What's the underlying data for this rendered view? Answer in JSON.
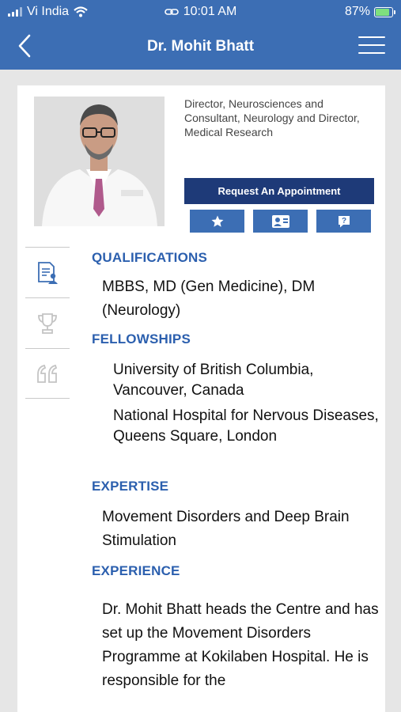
{
  "status": {
    "carrier": "Vi India",
    "time": "10:01 AM",
    "battery": "87%",
    "battery_level": 0.87
  },
  "nav": {
    "title": "Dr. Mohit Bhatt"
  },
  "profile": {
    "designation": "Director, Neurosciences and Consultant, Neurology and Director, Medical Research",
    "appointment_label": "Request An Appointment"
  },
  "sections": {
    "qualifications": {
      "heading": "QUALIFICATIONS",
      "text": "MBBS, MD (Gen Medicine), DM (Neurology)"
    },
    "fellowships": {
      "heading": "FELLOWSHIPS",
      "items": [
        "University of British Columbia, Vancouver, Canada",
        "National Hospital for Nervous Diseases, Queens Square, London"
      ]
    },
    "expertise": {
      "heading": "EXPERTISE",
      "text": "Movement Disorders and Deep Brain Stimulation"
    },
    "experience": {
      "heading": "EXPERIENCE",
      "text": "Dr. Mohit Bhatt heads the Centre and has set up the Movement Disorders Programme at Kokilaben Hospital. He is responsible for the"
    }
  },
  "colors": {
    "primary": "#3c6eb4",
    "dark_button": "#1e3a78",
    "heading": "#2b5fae"
  },
  "icons": [
    "back-icon",
    "menu-icon",
    "star-icon",
    "contact-card-icon",
    "question-icon",
    "document-user-icon",
    "trophy-icon",
    "quote-icon"
  ]
}
